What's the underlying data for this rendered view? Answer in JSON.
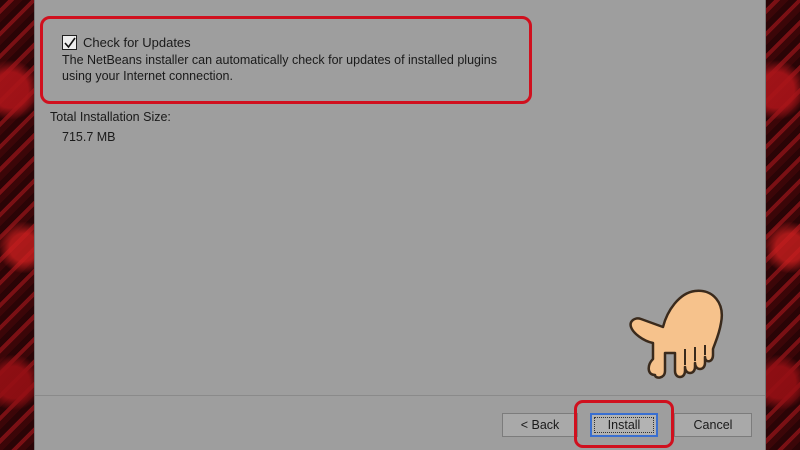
{
  "updates": {
    "checkbox_label": "Check for Updates",
    "checked": true,
    "description_line1": "The NetBeans installer can automatically check for updates of installed plugins",
    "description_line2": "using your Internet connection."
  },
  "install_size": {
    "label": "Total Installation Size:",
    "value": "715.7 MB"
  },
  "buttons": {
    "back": "< Back",
    "install": "Install",
    "cancel": "Cancel"
  },
  "colors": {
    "highlight": "#d0101e",
    "dialog_bg": "#9e9e9e",
    "hand_skin": "#f6c28c"
  },
  "icons": {
    "check": "check-icon",
    "pointer": "pointing-hand-icon"
  }
}
